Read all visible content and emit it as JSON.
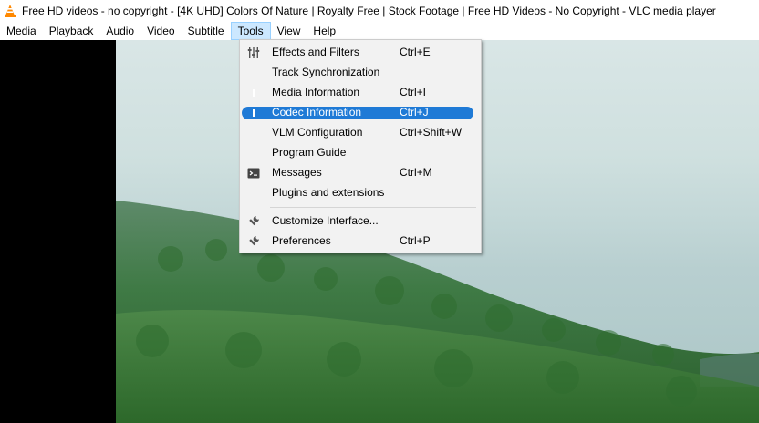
{
  "window": {
    "title": "Free HD videos - no copyright - [4K UHD] Colors Of Nature | Royalty Free | Stock Footage |  Free HD Videos - No Copyright - VLC media player"
  },
  "menubar": {
    "items": [
      "Media",
      "Playback",
      "Audio",
      "Video",
      "Subtitle",
      "Tools",
      "View",
      "Help"
    ],
    "active": "Tools"
  },
  "tools_menu": {
    "items": [
      {
        "label": "Effects and Filters",
        "shortcut": "Ctrl+E",
        "icon": "equalizer-icon"
      },
      {
        "label": "Track Synchronization",
        "shortcut": "",
        "icon": ""
      },
      {
        "label": "Media Information",
        "shortcut": "Ctrl+I",
        "icon": "info-icon"
      },
      {
        "label": "Codec Information",
        "shortcut": "Ctrl+J",
        "icon": "info-icon",
        "highlighted": true
      },
      {
        "label": "VLM Configuration",
        "shortcut": "Ctrl+Shift+W",
        "icon": ""
      },
      {
        "label": "Program Guide",
        "shortcut": "",
        "icon": ""
      },
      {
        "label": "Messages",
        "shortcut": "Ctrl+M",
        "icon": "terminal-icon"
      },
      {
        "label": "Plugins and extensions",
        "shortcut": "",
        "icon": ""
      },
      {
        "label": "Customize Interface...",
        "shortcut": "",
        "icon": "wrench-icon"
      },
      {
        "label": "Preferences",
        "shortcut": "Ctrl+P",
        "icon": "wrench-icon"
      }
    ]
  },
  "colors": {
    "highlight": "#1f7ad6",
    "info_icon": "#f39c12",
    "vlc_cone": "#ff8800"
  }
}
